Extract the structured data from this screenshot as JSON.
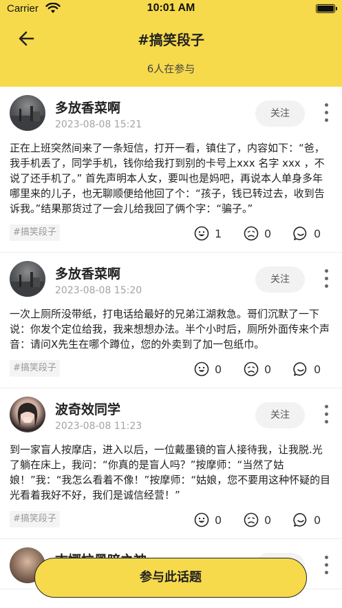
{
  "status_bar": {
    "carrier": "Carrier",
    "time": "10:01 AM"
  },
  "header": {
    "title": "#搞笑段子",
    "participants": "6人在参与",
    "background_color": "#f6da4c"
  },
  "posts": [
    {
      "username": "多放香菜啊",
      "time": "2023-08-08 15:21",
      "follow_label": "关注",
      "text": "正在上班突然间来了一条短信，打开一看，镇住了，内容如下：“爸，我手机丢了，同学手机，钱你给我打到别的卡号上xxx 名字 xxx ，不说了还手机了。” 首先声明本人女，要叫也是妈吧，再说本人单身多年哪里来的儿子，也无聊顺便给他回了个：“孩子，钱已转过去，收到告诉我。”结果那货过了一会儿给我回了俩个字：“骗子。”",
      "tag": "#搞笑段子",
      "likes": "1",
      "dislikes": "0",
      "comments": "0"
    },
    {
      "username": "多放香菜啊",
      "time": "2023-08-08 15:20",
      "follow_label": "关注",
      "text": "一次上厕所没带纸，打电话给最好的兄弟江湖救急。哥们沉默了一下说：你发个定位给我，我来想想办法。半个小时后，厕所外面传来个声音：请问X先生在哪个蹲位，您的外卖到了加一包纸巾。",
      "tag": "#搞笑段子",
      "likes": "0",
      "dislikes": "0",
      "comments": "0"
    },
    {
      "username": "波奇效同学",
      "time": "2023-08-08 11:23",
      "follow_label": "关注",
      "text": "到一家盲人按摩店，进入以后，一位戴墨镜的盲人接待我，让我脱.光了躺在床上，我问：“你真的是盲人吗？”按摩师：“当然了姑娘！”我：“我怎么看着不像！”按摩师：“姑娘，您不要用这种怀疑的目光看着我好不好，我们是诚信经营！”",
      "tag": "#搞笑段子",
      "likes": "0",
      "dislikes": "0",
      "comments": "0"
    },
    {
      "username": "古娜拉黑暗之神",
      "time": "",
      "follow_label": "关注",
      "text": "",
      "tag": "",
      "likes": "",
      "dislikes": "",
      "comments": ""
    }
  ],
  "join_button": {
    "label": "参与此话题"
  },
  "icons": {
    "back": "back-arrow-icon",
    "wifi": "wifi-icon",
    "battery": "battery-icon",
    "more": "more-vertical-icon",
    "like": "smile-icon",
    "dislike": "frown-icon",
    "comment": "comment-bubble-icon"
  }
}
